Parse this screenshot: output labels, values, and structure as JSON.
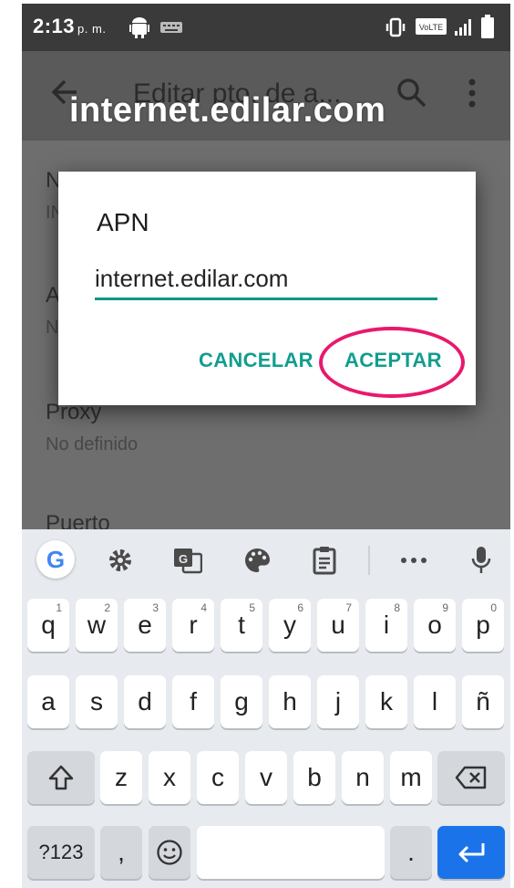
{
  "status_bar": {
    "time": "2:13",
    "ampm": "p. m.",
    "icons": [
      "android-icon",
      "keyboard-icon",
      "vibrate-icon",
      "volte-icon",
      "signal-icon",
      "battery-icon"
    ],
    "volte_label": "VoLTE"
  },
  "app_bar": {
    "title": "Editar pto. de a...",
    "back_icon": "arrow-back-icon",
    "search_icon": "search-icon",
    "more_icon": "more-vert-icon"
  },
  "watermark": "internet.edilar.com",
  "list": [
    {
      "title": "N",
      "subtitle": "IN"
    },
    {
      "title": "A",
      "subtitle": "N"
    },
    {
      "title": "Proxy",
      "subtitle": "No definido"
    },
    {
      "title": "Puerto",
      "subtitle": ""
    }
  ],
  "dialog": {
    "title": "APN",
    "input_value": "internet.edilar.com",
    "cancel_label": "CANCELAR",
    "ok_label": "ACEPTAR",
    "accent_color": "#009688",
    "highlight_color": "#e8196d"
  },
  "keyboard": {
    "toolbar": [
      "google-g-icon",
      "settings-icon",
      "translate-icon",
      "palette-icon",
      "clipboard-icon",
      "more-horiz-icon",
      "mic-icon"
    ],
    "google_letter": "G",
    "row1": [
      {
        "k": "q",
        "h": "1"
      },
      {
        "k": "w",
        "h": "2"
      },
      {
        "k": "e",
        "h": "3"
      },
      {
        "k": "r",
        "h": "4"
      },
      {
        "k": "t",
        "h": "5"
      },
      {
        "k": "y",
        "h": "6"
      },
      {
        "k": "u",
        "h": "7"
      },
      {
        "k": "i",
        "h": "8"
      },
      {
        "k": "o",
        "h": "9"
      },
      {
        "k": "p",
        "h": "0"
      }
    ],
    "row2": [
      "a",
      "s",
      "d",
      "f",
      "g",
      "h",
      "j",
      "k",
      "l",
      "ñ"
    ],
    "row3": [
      "z",
      "x",
      "c",
      "v",
      "b",
      "n",
      "m"
    ],
    "symbols_label": "?123",
    "comma_label": ",",
    "period_label": ".",
    "enter_color": "#1a73e8"
  }
}
